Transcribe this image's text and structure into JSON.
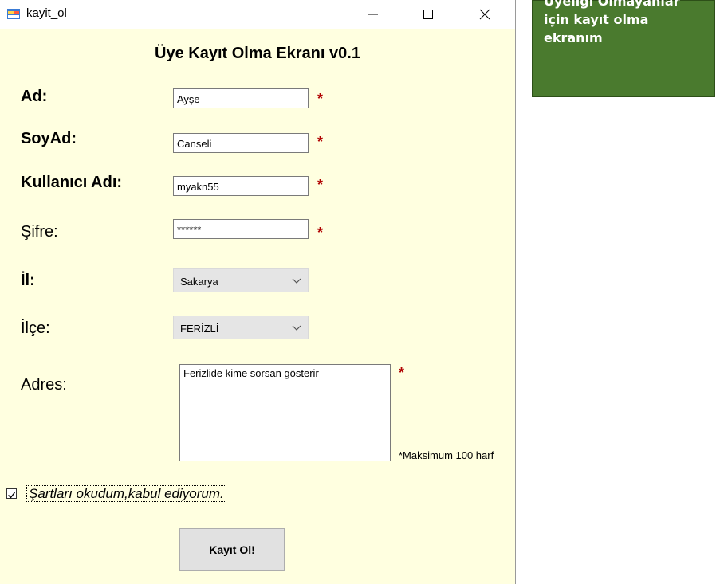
{
  "window": {
    "title": "kayit_ol",
    "controls": {
      "minimize": "–",
      "maximize": "☐",
      "close": "✕"
    }
  },
  "form": {
    "heading": "Üye Kayıt Olma Ekranı v0.1",
    "required_mark": "*",
    "fields": {
      "ad": {
        "label": "Ad:",
        "value": "Ayşe"
      },
      "soyad": {
        "label": "SoyAd:",
        "value": "Canseli"
      },
      "kullanici_adi": {
        "label": "Kullanıcı Adı:",
        "value": "myakn55"
      },
      "sifre": {
        "label": "Şifre:",
        "value": "******"
      },
      "il": {
        "label": "İl:",
        "selected": "Sakarya"
      },
      "ilce": {
        "label": "İlçe:",
        "selected": "FERİZLİ"
      },
      "adres": {
        "label": "Adres:",
        "value": "Ferizlide kime sorsan gösterir",
        "hint": "*Maksimum 100 harf"
      }
    },
    "terms": {
      "label": "Şartları okudum,kabul ediyorum.",
      "checked": true
    },
    "submit_label": "Kayıt Ol!"
  },
  "note": {
    "lines": [
      "Üyeliği Olmayanlar",
      "için kayıt olma",
      "ekranım"
    ]
  },
  "colors": {
    "form_background": "#ffffe0",
    "required": "#b00000",
    "note_background": "#4a7a2e"
  }
}
